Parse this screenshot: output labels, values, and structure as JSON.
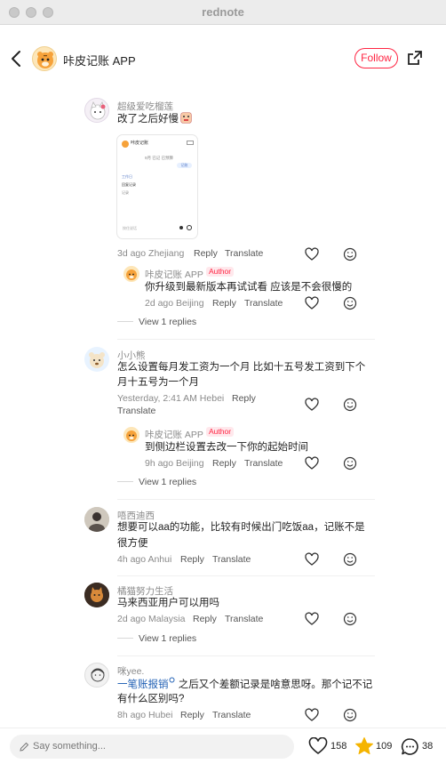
{
  "window": {
    "title": "rednote"
  },
  "header": {
    "app_name": "咔皮记账 APP",
    "follow_label": "Follow"
  },
  "comments": [
    {
      "name": "超级爱吃榴莲",
      "text": "改了之后好慢",
      "meta": "3d ago Zhejiang",
      "reply": "Reply",
      "translate": "Translate",
      "screenshot": {
        "title": "咔皮记账",
        "line": "9月 已记 已预算",
        "bubble": "记账",
        "items": [
          "工作日",
          "回复记录",
          "记录"
        ],
        "input": "按住说话"
      },
      "sub": {
        "name": "咔皮记账 APP",
        "badge": "Author",
        "text": "你升级到最新版本再试试看 应该是不会很慢的",
        "meta": "2d ago Beijing",
        "reply": "Reply",
        "translate": "Translate"
      },
      "view_replies": "View 1 replies"
    },
    {
      "name": "小小熊",
      "text_line1": "怎么设置每月发工资为一个月  比如十五号发工资到下个",
      "text_line2": "月十五号为一个月",
      "meta": "Yesterday, 2:41 AM Hebei",
      "reply": "Reply",
      "translate": "Translate",
      "sub": {
        "name": "咔皮记账 APP",
        "badge": "Author",
        "text": "到侧边栏设置去改一下你的起始时间",
        "meta": "9h ago Beijing",
        "reply": "Reply",
        "translate": "Translate"
      },
      "view_replies": "View 1 replies"
    },
    {
      "name": "唔西迪西",
      "text_line1": "想要可以aa的功能，比较有时候出门吃饭aa，记账不是",
      "text_line2": "很方便",
      "meta": "4h ago Anhui",
      "reply": "Reply",
      "translate": "Translate"
    },
    {
      "name": "橘猫努力生活",
      "text": "马来西亚用户可以用吗",
      "meta": "2d ago Malaysia",
      "reply": "Reply",
      "translate": "Translate",
      "view_replies": "View 1 replies"
    },
    {
      "name": "咪yee.",
      "link": "一笔账报销",
      "text_rest": " 之后又个差额记录是啥意思呀。那个记不记",
      "text_line2": "有什么区别吗?",
      "meta": "8h ago Hubei",
      "reply": "Reply",
      "translate": "Translate"
    }
  ],
  "bottom": {
    "placeholder": "Say something...",
    "likes": "158",
    "stars": "109",
    "comments": "38"
  },
  "colors": {
    "accent": "#ff2442",
    "link": "#1f5fb4",
    "star": "#f5b400"
  }
}
